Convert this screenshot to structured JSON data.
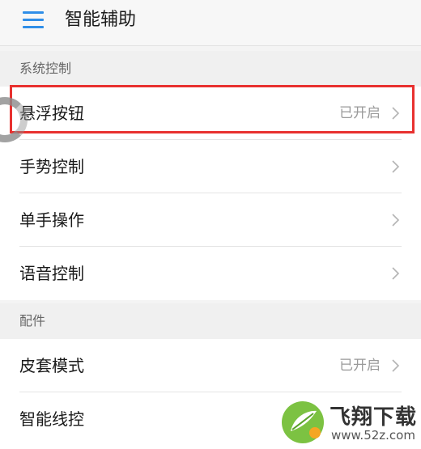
{
  "header": {
    "title": "智能辅助",
    "menu_icon": "hamburger-menu-icon",
    "accent": "#2f8ee8"
  },
  "sections": [
    {
      "title": "系统控制",
      "items": [
        {
          "label": "悬浮按钮",
          "status": "已开启",
          "highlighted": true
        },
        {
          "label": "手势控制",
          "status": ""
        },
        {
          "label": "单手操作",
          "status": ""
        },
        {
          "label": "语音控制",
          "status": ""
        }
      ]
    },
    {
      "title": "配件",
      "items": [
        {
          "label": "皮套模式",
          "status": "已开启"
        },
        {
          "label": "智能线控",
          "status": ""
        }
      ]
    }
  ],
  "highlight_color": "#e8312f",
  "watermark": {
    "text": "飞翔下载",
    "url": "www.52z.com"
  }
}
